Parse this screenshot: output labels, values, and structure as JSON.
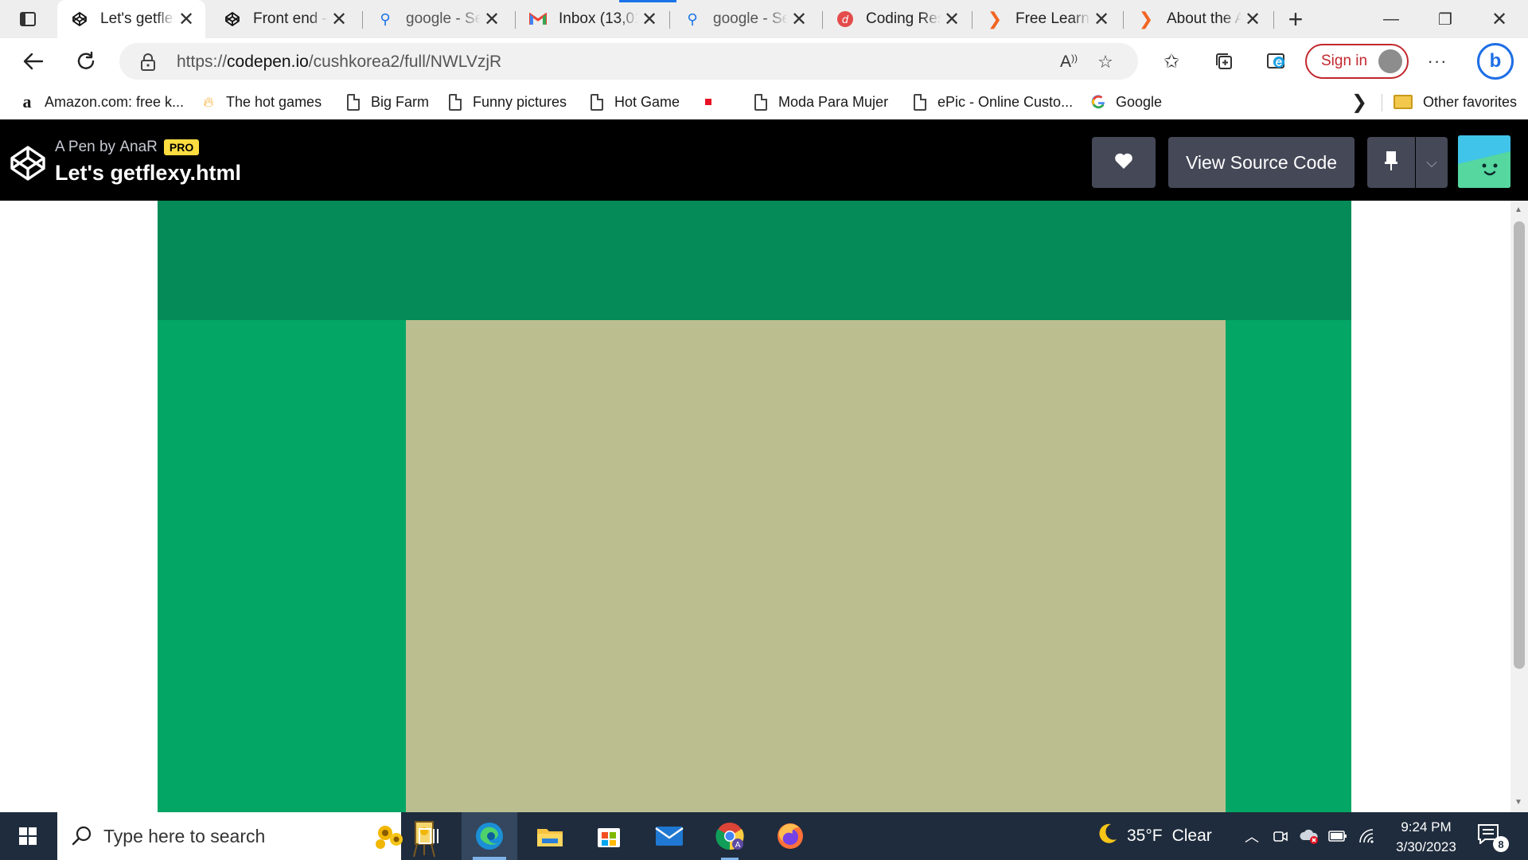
{
  "browser": {
    "tabs": [
      {
        "title": "Let's getflexy.html",
        "icon": "codepen-icon",
        "active": true
      },
      {
        "title": "Front end - CodePen",
        "icon": "codepen-icon",
        "active": false
      },
      {
        "title": "google - Search",
        "icon": "search-icon",
        "active": false
      },
      {
        "title": "Inbox (13,01...",
        "icon": "gmail-icon",
        "active": false
      },
      {
        "title": "google - Search",
        "icon": "search-icon",
        "active": false
      },
      {
        "title": "Coding Resources",
        "icon": "coding-resources-icon",
        "active": false
      },
      {
        "title": "Free Learning",
        "icon": "chevron-orange-icon",
        "active": false
      },
      {
        "title": "About the A...",
        "icon": "chevron-orange-icon",
        "active": false
      }
    ],
    "address": {
      "scheme": "https://",
      "host": "codepen.io",
      "path": "/cushkorea2/full/NWLVzjR"
    },
    "sign_in_label": "Sign in",
    "favorites": [
      {
        "label": "Amazon.com: free k...",
        "icon": "amazon-icon"
      },
      {
        "label": "The hot games",
        "icon": "flame-icon"
      },
      {
        "label": "Big Farm",
        "icon": "page-icon"
      },
      {
        "label": "Funny pictures",
        "icon": "page-icon"
      },
      {
        "label": "Hot Game",
        "icon": "page-icon"
      },
      {
        "label": "",
        "icon": "red-square-icon"
      },
      {
        "label": "Moda Para Mujer",
        "icon": "page-icon"
      },
      {
        "label": "ePic - Online Custo...",
        "icon": "page-icon"
      },
      {
        "label": "Google",
        "icon": "google-icon"
      }
    ],
    "other_favorites_label": "Other favorites"
  },
  "codepen": {
    "byline_prefix": "A Pen by",
    "author": "AnaR",
    "pro_label": "PRO",
    "pen_title": "Let's getflexy.html",
    "view_source_label": "View Source Code"
  },
  "pen_output": {
    "colors": {
      "header": "#048b58",
      "sidebar": "#03a665",
      "main": "#bbbf90"
    }
  },
  "taskbar": {
    "search_placeholder": "Type here to search",
    "weather": {
      "temp": "35°F",
      "condition": "Clear"
    },
    "time": "9:24 PM",
    "date": "3/30/2023",
    "notification_count": "8"
  }
}
